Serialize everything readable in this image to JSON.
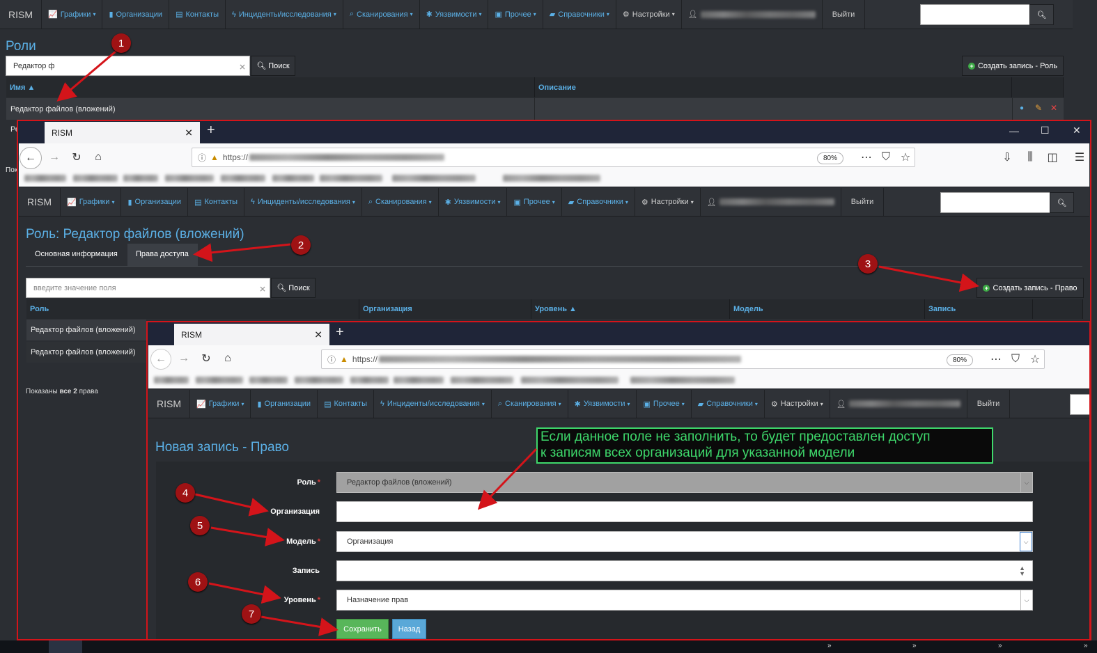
{
  "nav": {
    "brand": "RISM",
    "items": [
      {
        "icon": "chart-icon",
        "label": "Графики",
        "caret": true
      },
      {
        "icon": "bar-chart-icon",
        "label": "Организации",
        "caret": false
      },
      {
        "icon": "contact-card-icon",
        "label": "Контакты",
        "caret": false
      },
      {
        "icon": "bolt-icon",
        "label": "Инциденты/исследования",
        "caret": true
      },
      {
        "icon": "search-icon",
        "label": "Сканирования",
        "caret": true
      },
      {
        "icon": "bug-icon",
        "label": "Уязвимости",
        "caret": true
      },
      {
        "icon": "box-icon",
        "label": "Прочее",
        "caret": true
      },
      {
        "icon": "book-icon",
        "label": "Справочники",
        "caret": true
      }
    ],
    "settings": "Настройки",
    "logout": "Выйти"
  },
  "roles_page": {
    "title": "Роли",
    "filter_value": "Редактор ф",
    "search_button": "Поиск",
    "create_button": "Создать запись - Роль",
    "columns": [
      "Имя ▲",
      "Описание"
    ],
    "rows": [
      {
        "name": "Редактор файлов (вложений)",
        "description": ""
      }
    ],
    "partial_row": "Ре",
    "partial_footer": "Пок"
  },
  "browser1": {
    "tab_title": "RISM",
    "url_prefix": "https://",
    "zoom": "80%"
  },
  "role_page": {
    "title": "Роль: Редактор файлов (вложений)",
    "tabs": [
      "Основная информация",
      "Права доступа"
    ],
    "filter_placeholder": "введите значение поля",
    "search_button": "Поиск",
    "create_button": "Создать запись - Право",
    "columns": [
      "Роль",
      "Организация",
      "Уровень ▲",
      "Модель",
      "Запись"
    ],
    "rows": [
      "Редактор файлов (вложений)",
      "Редактор файлов (вложений)"
    ],
    "footer_prefix": "Показаны ",
    "footer_bold": "все 2",
    "footer_suffix": " права"
  },
  "browser2": {
    "tab_title": "RISM",
    "url_prefix": "https://",
    "zoom": "80%"
  },
  "form": {
    "title": "Новая запись - Право",
    "note_line1": "Если данное поле не заполнить, то будет предоставлен доступ",
    "note_line2": "к записям всех организаций для указанной модели",
    "fields": [
      {
        "label": "Роль",
        "required": true,
        "value": "Редактор файлов (вложений)"
      },
      {
        "label": "Организация",
        "required": false,
        "value": ""
      },
      {
        "label": "Модель",
        "required": true,
        "value": "Организация"
      },
      {
        "label": "Запись",
        "required": false,
        "value": ""
      },
      {
        "label": "Уровень",
        "required": true,
        "value": "Назначение прав"
      }
    ],
    "save_button": "Сохранить",
    "back_button": "Назад"
  },
  "markers": [
    "1",
    "2",
    "3",
    "4",
    "5",
    "6",
    "7"
  ],
  "colors": {
    "accent": "#5bb0e6",
    "frame": "#d4141a",
    "marker": "#9f1214",
    "note": "#3ed86b",
    "save": "#58b65a",
    "back": "#5aa8d8"
  }
}
